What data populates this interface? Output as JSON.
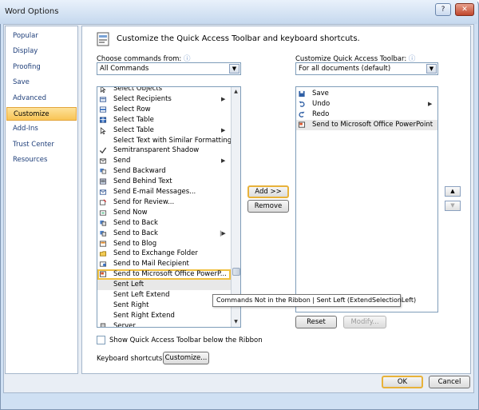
{
  "window": {
    "title": "Word Options"
  },
  "nav": {
    "items": [
      {
        "label": "Popular"
      },
      {
        "label": "Display"
      },
      {
        "label": "Proofing"
      },
      {
        "label": "Save"
      },
      {
        "label": "Advanced"
      },
      {
        "label": "Customize",
        "selected": true
      },
      {
        "label": "Add-Ins"
      },
      {
        "label": "Trust Center"
      },
      {
        "label": "Resources"
      }
    ]
  },
  "header": {
    "text": "Customize the Quick Access Toolbar and keyboard shortcuts."
  },
  "left": {
    "label": "Choose commands from:",
    "combo_value": "All Commands",
    "commands": [
      {
        "label": "Select Objects",
        "icon": "cursor-icon"
      },
      {
        "label": "Select Recipients",
        "icon": "recipients-icon",
        "submenu": true
      },
      {
        "label": "Select Row",
        "icon": "table-row-icon"
      },
      {
        "label": "Select Table",
        "icon": "table-icon"
      },
      {
        "label": "Select Table",
        "icon": "cursor-icon",
        "submenu": true
      },
      {
        "label": "Select Text with Similar Formatting",
        "icon": ""
      },
      {
        "label": "Semitransparent Shadow",
        "icon": "checkmark-icon"
      },
      {
        "label": "Send",
        "icon": "send-icon",
        "submenu": true
      },
      {
        "label": "Send Backward",
        "icon": "send-backward-icon"
      },
      {
        "label": "Send Behind Text",
        "icon": "send-behind-text-icon"
      },
      {
        "label": "Send E-mail Messages...",
        "icon": "email-icon"
      },
      {
        "label": "Send for Review...",
        "icon": "review-icon"
      },
      {
        "label": "Send Now",
        "icon": "send-now-icon"
      },
      {
        "label": "Send to Back",
        "icon": "send-to-back-icon"
      },
      {
        "label": "Send to Back",
        "icon": "send-to-back-icon",
        "submenu_bar": true
      },
      {
        "label": "Send to Blog",
        "icon": "blog-icon"
      },
      {
        "label": "Send to Exchange Folder",
        "icon": "exchange-folder-icon"
      },
      {
        "label": "Send to Mail Recipient",
        "icon": "mail-recipient-icon"
      },
      {
        "label": "Send to Microsoft Office PowerP...",
        "icon": "powerpoint-icon",
        "highlighted": true
      },
      {
        "label": "Sent Left",
        "icon": "",
        "selected": true
      },
      {
        "label": "Sent Left Extend",
        "icon": ""
      },
      {
        "label": "Sent Right",
        "icon": ""
      },
      {
        "label": "Sent Right Extend",
        "icon": ""
      },
      {
        "label": "Server",
        "icon": "server-icon"
      }
    ]
  },
  "middle": {
    "add_label": "Add >>",
    "remove_label": "Remove"
  },
  "right": {
    "label": "Customize Quick Access Toolbar:",
    "combo_value": "For all documents (default)",
    "items": [
      {
        "label": "Save",
        "icon": "save-icon"
      },
      {
        "label": "Undo",
        "icon": "undo-icon",
        "submenu": true
      },
      {
        "label": "Redo",
        "icon": "redo-icon"
      },
      {
        "label": "Send to Microsoft Office PowerPoint",
        "icon": "powerpoint-icon",
        "selected": true
      }
    ],
    "reset_label": "Reset",
    "modify_label": "Modify..."
  },
  "tooltip": {
    "text": "Commands Not in the Ribbon | Sent Left (ExtendSelectionLeft)"
  },
  "bottom": {
    "checkbox_label": "Show Quick Access Toolbar below the Ribbon",
    "keyboard_label": "Keyboard shortcuts:",
    "customize_label": "Customize..."
  },
  "footer": {
    "ok_label": "OK",
    "cancel_label": "Cancel"
  },
  "colors": {
    "accent_highlight": "#f0c040",
    "selection": "#e8e8e8"
  }
}
